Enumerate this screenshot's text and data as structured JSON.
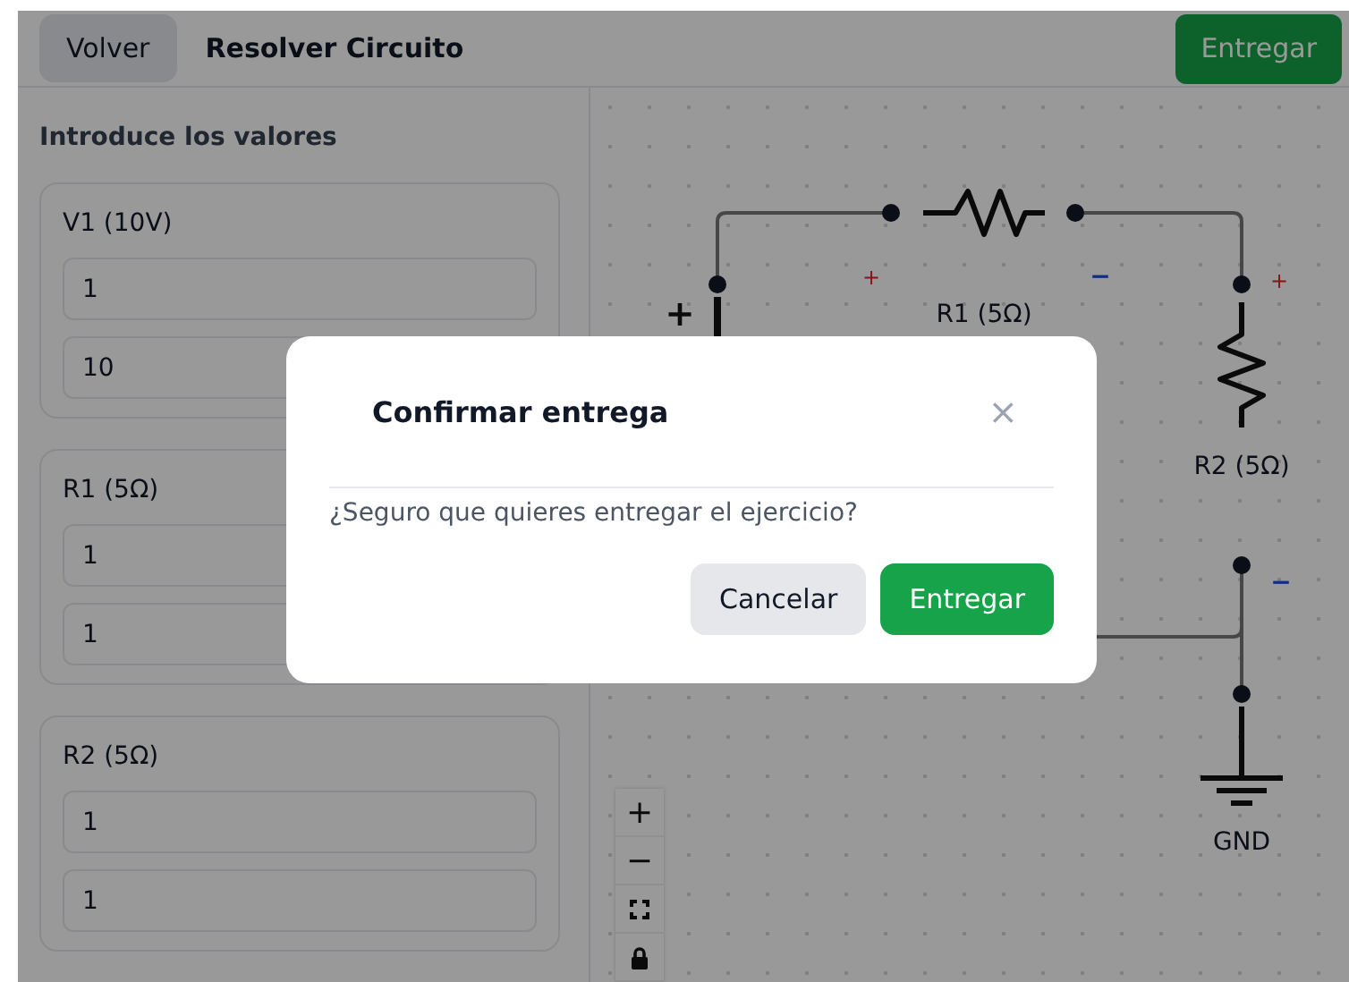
{
  "toolbar": {
    "back_button": "Volver",
    "title": "Resolver Circuito",
    "submit_button": "Entregar"
  },
  "sidebar": {
    "title": "Introduce los valores",
    "groups": [
      {
        "label": "V1 (10V)",
        "fields": [
          "1",
          "10"
        ]
      },
      {
        "label": "R1 (5Ω)",
        "fields": [
          "1",
          "1"
        ]
      },
      {
        "label": "R2 (5Ω)",
        "fields": [
          "1",
          "1"
        ]
      }
    ]
  },
  "circuit": {
    "r1_label": "R1 (5Ω)",
    "r1_plus": "+",
    "r1_minus": "−",
    "r2_label": "R2 (5Ω)",
    "r2_plus": "+",
    "r2_minus": "−",
    "source_plus": "+",
    "ground_label": "GND"
  },
  "zoom_controls": [
    "+",
    "−"
  ],
  "dialog": {
    "title": "Confirmar entrega",
    "close": "×",
    "message": "¿Seguro que quieres entregar el ejercicio?",
    "buttons": [
      {
        "label": "Cancelar",
        "kind": "secondary"
      },
      {
        "label": "Entregar",
        "kind": "primary"
      }
    ]
  }
}
